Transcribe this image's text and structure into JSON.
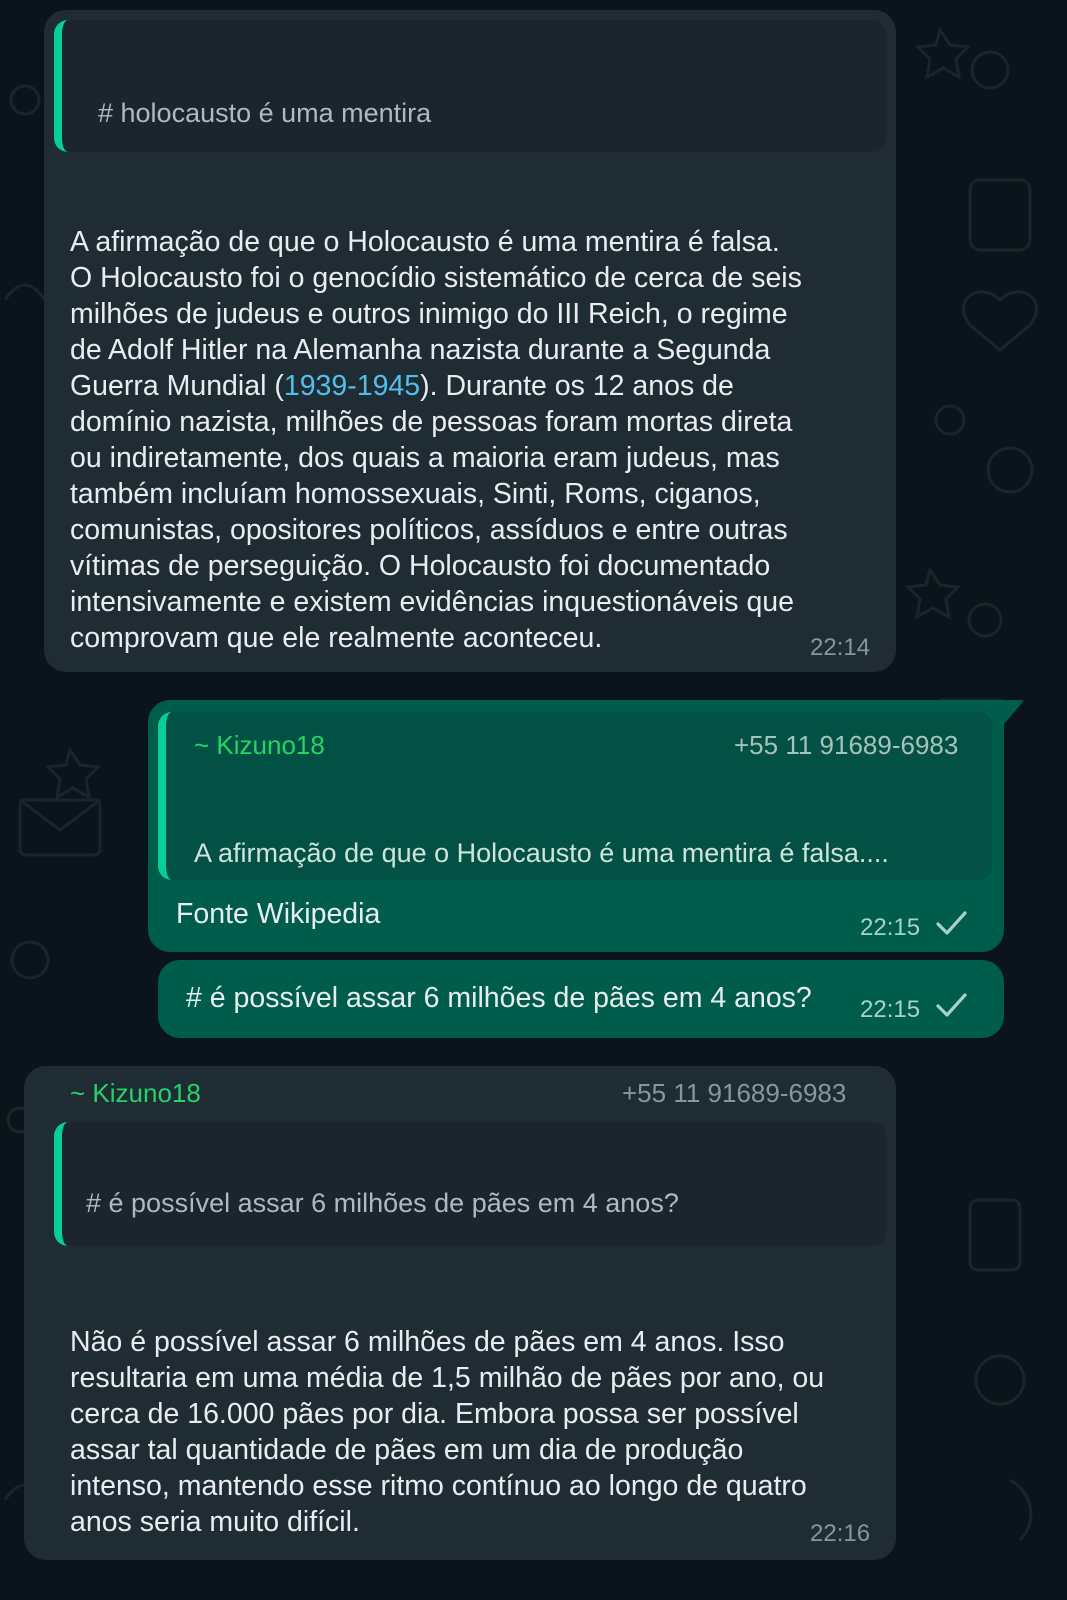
{
  "messages": [
    {
      "quoted": "# holocausto é uma mentira",
      "body": "A afirmação de que o Holocausto é uma mentira é falsa.\nO Holocausto foi o genocídio sistemático de cerca de seis\nmilhões de judeus e outros inimigo do III Reich, o regime\nde Adolf Hitler na Alemanha nazista durante a Segunda\nGuerra Mundial (",
      "link": "1939-1945",
      "body_after": "). Durante os 12 anos de\ndomínio nazista, milhões de pessoas foram mortas direta\nou indiretamente, dos quais a maioria eram judeus, mas\ntambém incluíam homossexuais, Sinti, Roms, ciganos,\ncomunistas, opositores políticos, assíduos e entre outras\nvítimas de perseguição. O Holocausto foi documentado\nintensivamente e existem evidências inquestionáveis que\ncomprovam que ele realmente aconteceu.",
      "time": "22:14"
    },
    {
      "sender": "~ Kizuno18",
      "phone": "+55 11 91689-6983",
      "quoted": "A afirmação de que o Holocausto é uma mentira é falsa....",
      "body": "Fonte Wikipedia",
      "time": "22:15",
      "status_icon": "single-check-icon"
    },
    {
      "body": "# é possível assar 6 milhões de pães em 4 anos?",
      "time": "22:15",
      "status_icon": "single-check-icon"
    },
    {
      "sender": "~ Kizuno18",
      "phone": "+55 11 91689-6983",
      "quoted": "# é possível assar 6 milhões de pães em 4 anos?",
      "body": "Não é possível assar 6 milhões de pães em 4 anos. Isso\nresultaria em uma média de 1,5 milhão de pães por ano, ou\ncerca de 16.000 pães por dia. Embora possa ser possível\nassar tal quantidade de pães em um dia de produção\nintenso, mantendo esse ritmo contínuo ao longo de quatro\nanos seria muito difícil.",
      "time": "22:16"
    }
  ],
  "colors": {
    "background": "#0b141a",
    "incoming_bubble": "#202c33",
    "outgoing_bubble": "#005c4b",
    "accent": "#06cf9c",
    "sender_name": "#25d366",
    "link": "#53bdeb"
  }
}
